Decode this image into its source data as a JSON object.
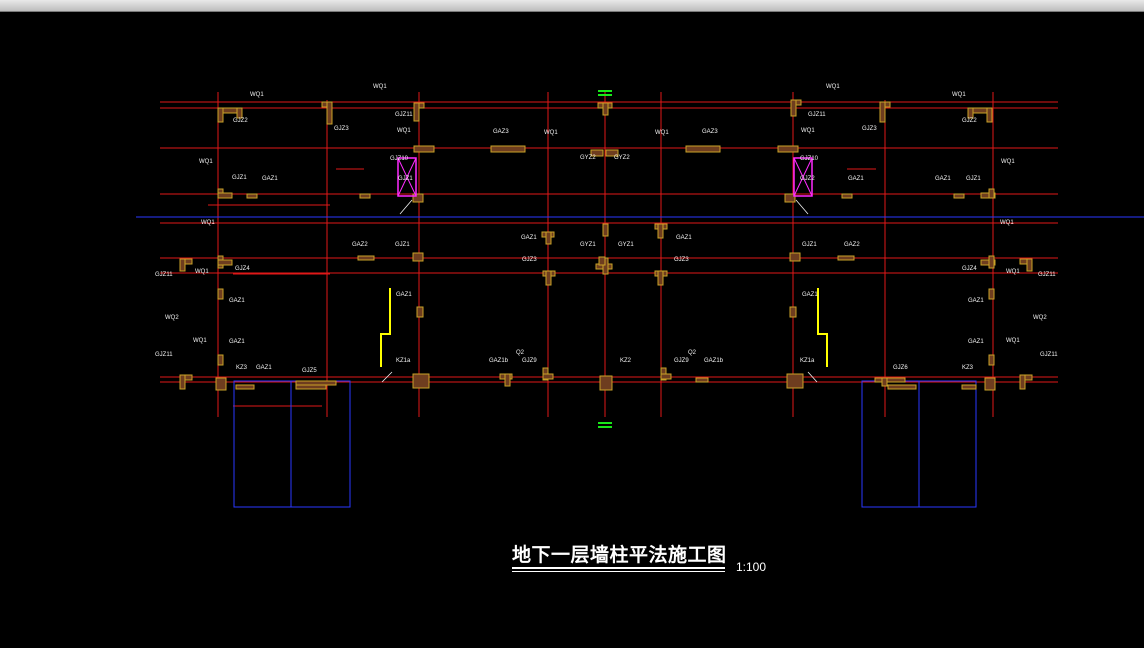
{
  "window": {
    "titlebar": ""
  },
  "drawing": {
    "title": "地下一层墙柱平法施工图",
    "scale": "1:100",
    "colors": {
      "background": "#000000",
      "axis": "#e01818",
      "column": "#c9a227",
      "column_fill": "#6e3d1f",
      "highlight": "#ff2bff",
      "guide": "#2a38ff",
      "section_mark": "#19e619",
      "text": "#f2f2f2",
      "yellow": "#ffff00"
    }
  },
  "labels": [
    {
      "id": "wq1-a",
      "text": "WQ1"
    },
    {
      "id": "wq1-b",
      "text": "WQ1"
    },
    {
      "id": "gjz2-a",
      "text": "GJZ2"
    },
    {
      "id": "gjz3-a",
      "text": "GJZ3"
    },
    {
      "id": "gjz11-a",
      "text": "GJZ11"
    },
    {
      "id": "wq1-c",
      "text": "WQ1"
    },
    {
      "id": "gaz3-a",
      "text": "GAZ3"
    },
    {
      "id": "wq1-d",
      "text": "WQ1"
    },
    {
      "id": "gjz10-a",
      "text": "GJZ10"
    },
    {
      "id": "gyz2-a",
      "text": "GYZ2"
    },
    {
      "id": "gyz2-b",
      "text": "GYZ2"
    },
    {
      "id": "wq1-e",
      "text": "WQ1"
    },
    {
      "id": "gaz3-b",
      "text": "GAZ3"
    },
    {
      "id": "wq1-f",
      "text": "WQ1"
    },
    {
      "id": "gjz11-b",
      "text": "GJZ11"
    },
    {
      "id": "gjz10-b",
      "text": "GJZ10"
    },
    {
      "id": "gjz3-b",
      "text": "GJZ3"
    },
    {
      "id": "wq1-g",
      "text": "WQ1"
    },
    {
      "id": "gjz2-b",
      "text": "GJZ2"
    },
    {
      "id": "wq1-h",
      "text": "WQ1"
    },
    {
      "id": "wq1-i",
      "text": "WQ1"
    },
    {
      "id": "gjz1-a",
      "text": "GJZ1"
    },
    {
      "id": "gaz1-a",
      "text": "GAZ1"
    },
    {
      "id": "gjz1-b",
      "text": "GJZ1"
    },
    {
      "id": "gjz2-c",
      "text": "GJZ2"
    },
    {
      "id": "gaz1-b",
      "text": "GAZ1"
    },
    {
      "id": "gaz1-c",
      "text": "GAZ1"
    },
    {
      "id": "gjz1-c",
      "text": "GJZ1"
    },
    {
      "id": "wq1-j",
      "text": "WQ1"
    },
    {
      "id": "wq1-k",
      "text": "WQ1"
    },
    {
      "id": "wq1-l",
      "text": "WQ1"
    },
    {
      "id": "gaz1-d",
      "text": "GAZ1"
    },
    {
      "id": "gaz1-e",
      "text": "GAZ1"
    },
    {
      "id": "gaz2-a",
      "text": "GAZ2"
    },
    {
      "id": "gjz1-d",
      "text": "GJZ1"
    },
    {
      "id": "gyz1-a",
      "text": "GYZ1"
    },
    {
      "id": "gyz1-b",
      "text": "GYZ1"
    },
    {
      "id": "gjz1-e",
      "text": "GJZ1"
    },
    {
      "id": "gaz2-b",
      "text": "GAZ2"
    },
    {
      "id": "gjz11-c",
      "text": "GJZ11"
    },
    {
      "id": "wq1-m",
      "text": "WQ1"
    },
    {
      "id": "gjz4-a",
      "text": "GJZ4"
    },
    {
      "id": "gjz3-c",
      "text": "GJZ3"
    },
    {
      "id": "gjz3-d",
      "text": "GJZ3"
    },
    {
      "id": "gjz4-b",
      "text": "GJZ4"
    },
    {
      "id": "wq1-n",
      "text": "WQ1"
    },
    {
      "id": "gjz11-d",
      "text": "GJZ11"
    },
    {
      "id": "gaz1-f",
      "text": "GAZ1"
    },
    {
      "id": "gaz1-g",
      "text": "GAZ1"
    },
    {
      "id": "gaz1-h",
      "text": "GAZ1"
    },
    {
      "id": "gaz1-i",
      "text": "GAZ1"
    },
    {
      "id": "wq2-a",
      "text": "WQ2"
    },
    {
      "id": "wq2-b",
      "text": "WQ2"
    },
    {
      "id": "gjz11-e",
      "text": "GJZ11"
    },
    {
      "id": "wq1-o",
      "text": "WQ1"
    },
    {
      "id": "gaz1-j",
      "text": "GAZ1"
    },
    {
      "id": "gaz1-k",
      "text": "GAZ1"
    },
    {
      "id": "wq1-p",
      "text": "WQ1"
    },
    {
      "id": "gjz11-f",
      "text": "GJZ11"
    },
    {
      "id": "kz3-a",
      "text": "KZ3"
    },
    {
      "id": "gaz1-l",
      "text": "GAZ1"
    },
    {
      "id": "gjz5-a",
      "text": "GJZ5"
    },
    {
      "id": "kz1a-a",
      "text": "KZ1a"
    },
    {
      "id": "gaz1b-a",
      "text": "GAZ1b"
    },
    {
      "id": "q2-a",
      "text": "Q2"
    },
    {
      "id": "gjz9-a",
      "text": "GJZ9"
    },
    {
      "id": "kz2-a",
      "text": "KZ2"
    },
    {
      "id": "q2-b",
      "text": "Q2"
    },
    {
      "id": "gjz9-b",
      "text": "GJZ9"
    },
    {
      "id": "gaz1b-b",
      "text": "GAZ1b"
    },
    {
      "id": "kz1a-b",
      "text": "KZ1a"
    },
    {
      "id": "gjz6-a",
      "text": "GJZ6"
    },
    {
      "id": "kz3-b",
      "text": "KZ3"
    }
  ]
}
